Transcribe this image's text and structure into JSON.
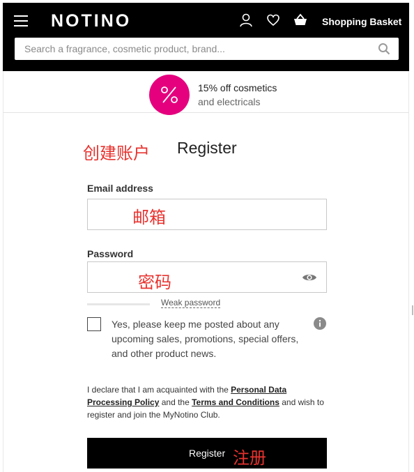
{
  "header": {
    "logo": "NOTINO",
    "basket_label": "Shopping Basket",
    "icons": [
      "menu-icon",
      "user-icon",
      "heart-icon",
      "basket-icon"
    ],
    "background": "#000000"
  },
  "search": {
    "placeholder": "Search a fragrance, cosmetic product, brand...",
    "value": ""
  },
  "promo": {
    "badge_symbol": "%",
    "badge_color": "#e5007e",
    "line1": "15% off cosmetics",
    "line2": "and electricals"
  },
  "annotations": {
    "title": "创建账户",
    "email": "邮箱",
    "password": "密码",
    "register": "注册",
    "color": "#e8332f"
  },
  "form": {
    "title": "Register",
    "email_label": "Email address",
    "email_value": "",
    "password_label": "Password",
    "password_value": "",
    "strength_text": "Weak password",
    "newsletter_text": "Yes, please keep me posted about any upcoming sales, promotions, special offers, and other product news.",
    "newsletter_checked": false,
    "legal": {
      "prefix": "I declare that I am acquainted with the ",
      "privacy_link": "Personal Data Processing Policy",
      "middle": " and the ",
      "terms_link": "Terms and Conditions",
      "suffix": " and wish to register and join the MyNotino Club."
    },
    "register_button": "Register"
  }
}
